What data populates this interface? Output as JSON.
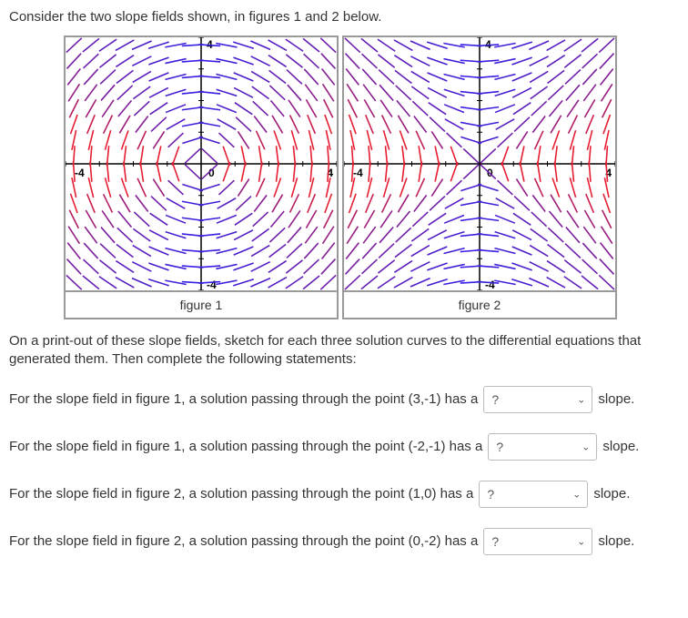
{
  "prompt": "Consider the two slope fields shown, in figures 1 and 2 below.",
  "figures": {
    "fig1_caption": "figure 1",
    "fig2_caption": "figure 2",
    "axis_labels": {
      "xmin": "-4",
      "xmax": "4",
      "ymin": "-4",
      "ymax": "4",
      "origin": "0"
    }
  },
  "instructions": "On a print-out of these slope fields, sketch for each three solution curves to the differential equations that generated them. Then complete the following statements:",
  "questions": {
    "q1_pre": "For the slope field in figure 1, a solution passing through the point (3,-1) has a",
    "q2_pre": "For the slope field in figure 1, a solution passing through the point (-2,-1) has a",
    "q3_pre": "For the slope field in figure 2, a solution passing through the point (1,0) has a",
    "q4_pre": "For the slope field in figure 2, a solution passing through the point (0,-2) has a",
    "placeholder": "?",
    "tail": "slope."
  },
  "chart_data": [
    {
      "type": "vector_field",
      "title": "figure 1",
      "xlim": [
        -4,
        4
      ],
      "ylim": [
        -4,
        4
      ],
      "formula_approx": "dy/dx ≈ -x / y  (circular / rotational slope field)",
      "grid_step": 0.5,
      "segment_length": 0.35,
      "color_scheme": "red-blue gradient across slope sign"
    },
    {
      "type": "vector_field",
      "title": "figure 2",
      "xlim": [
        -4,
        4
      ],
      "ylim": [
        -4,
        4
      ],
      "formula_approx": "dy/dx ≈ x / y (hyperbolic / saddle slope field)",
      "grid_step": 0.5,
      "segment_length": 0.35,
      "color_scheme": "red-blue gradient across slope sign"
    }
  ]
}
